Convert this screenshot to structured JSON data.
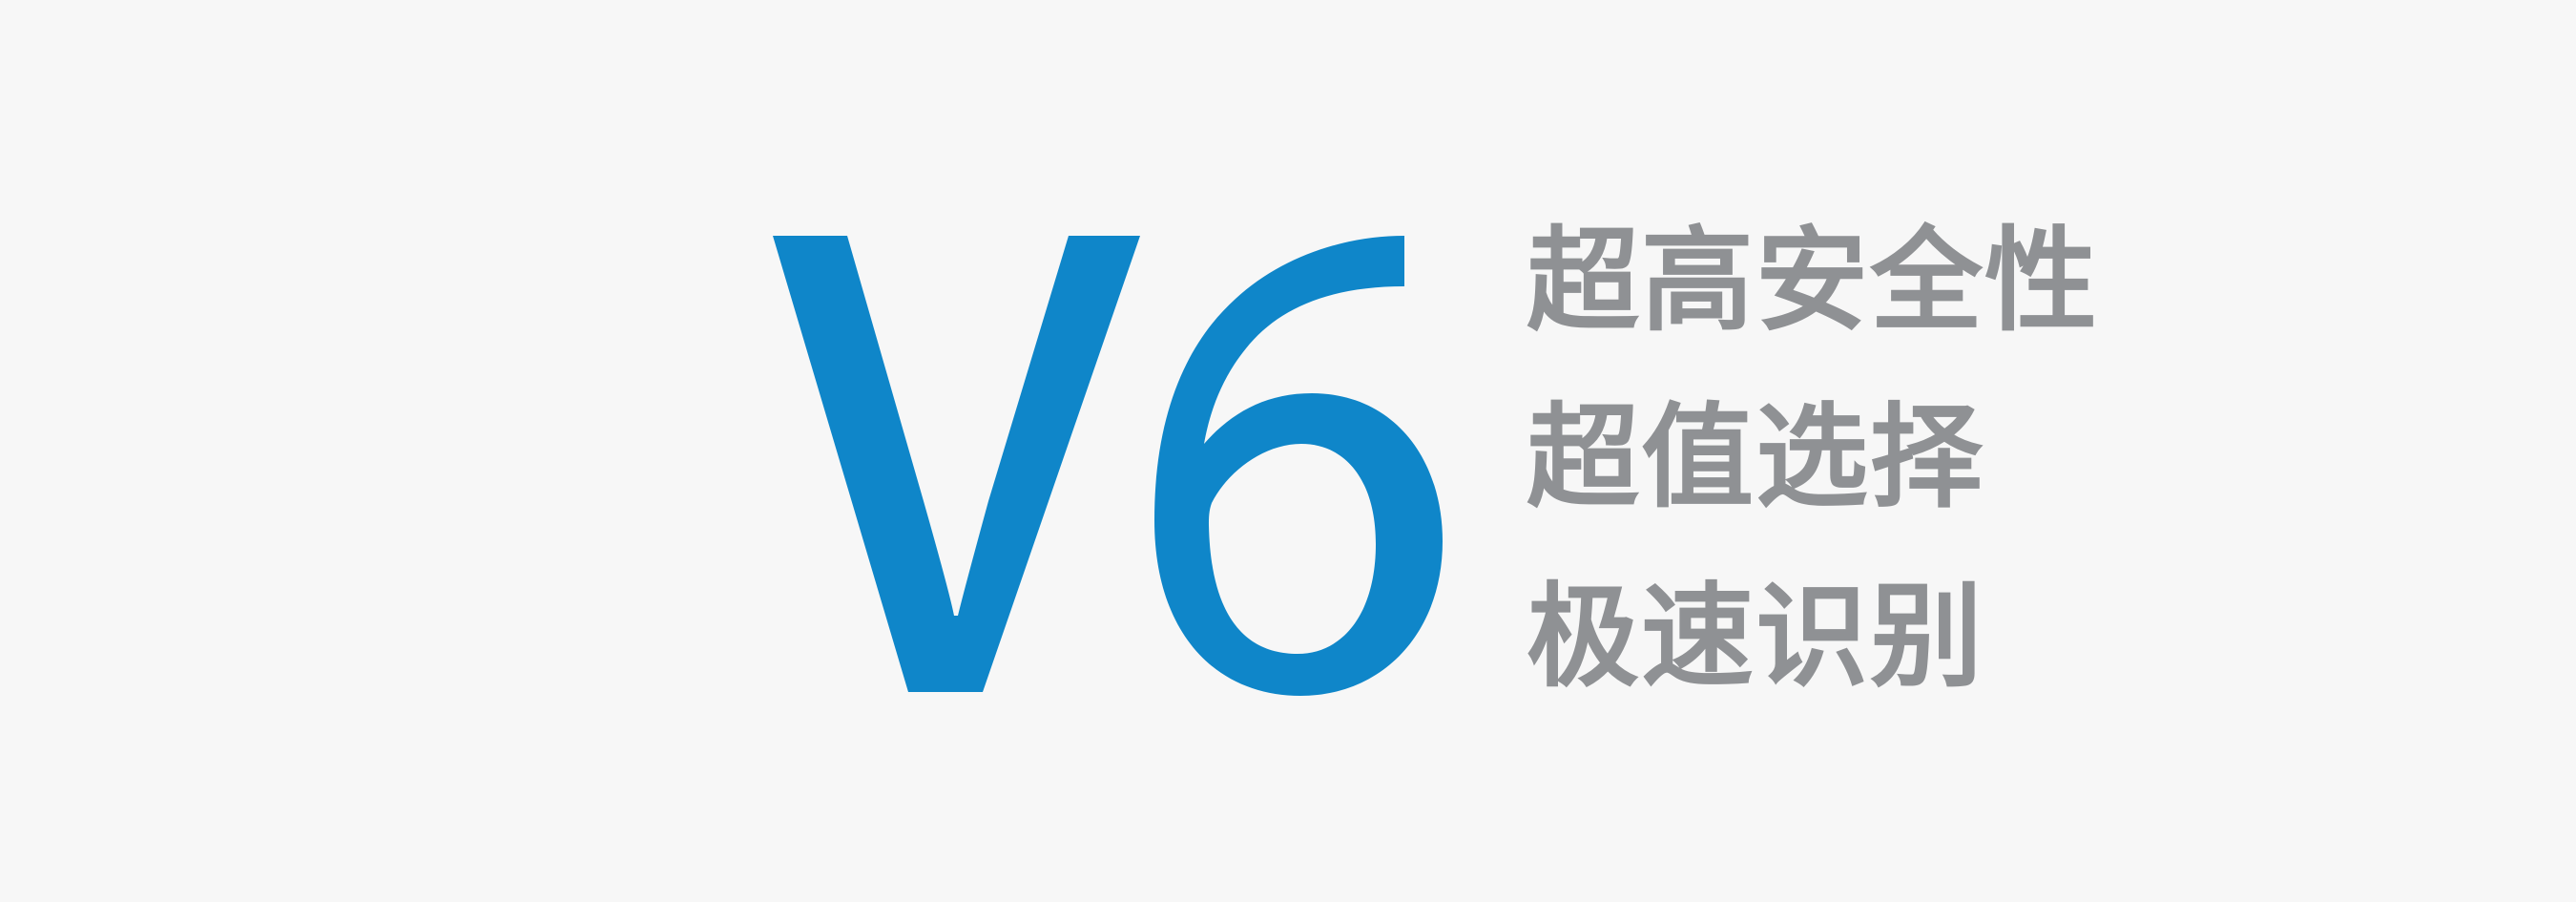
{
  "brand": {
    "model": "V6",
    "accent_color": "#0f86c9",
    "text_color": "#8f9194",
    "background_color": "#f7f7f7"
  },
  "features": [
    {
      "label": "超高安全性"
    },
    {
      "label": "超值选择"
    },
    {
      "label": "极速识别"
    }
  ]
}
